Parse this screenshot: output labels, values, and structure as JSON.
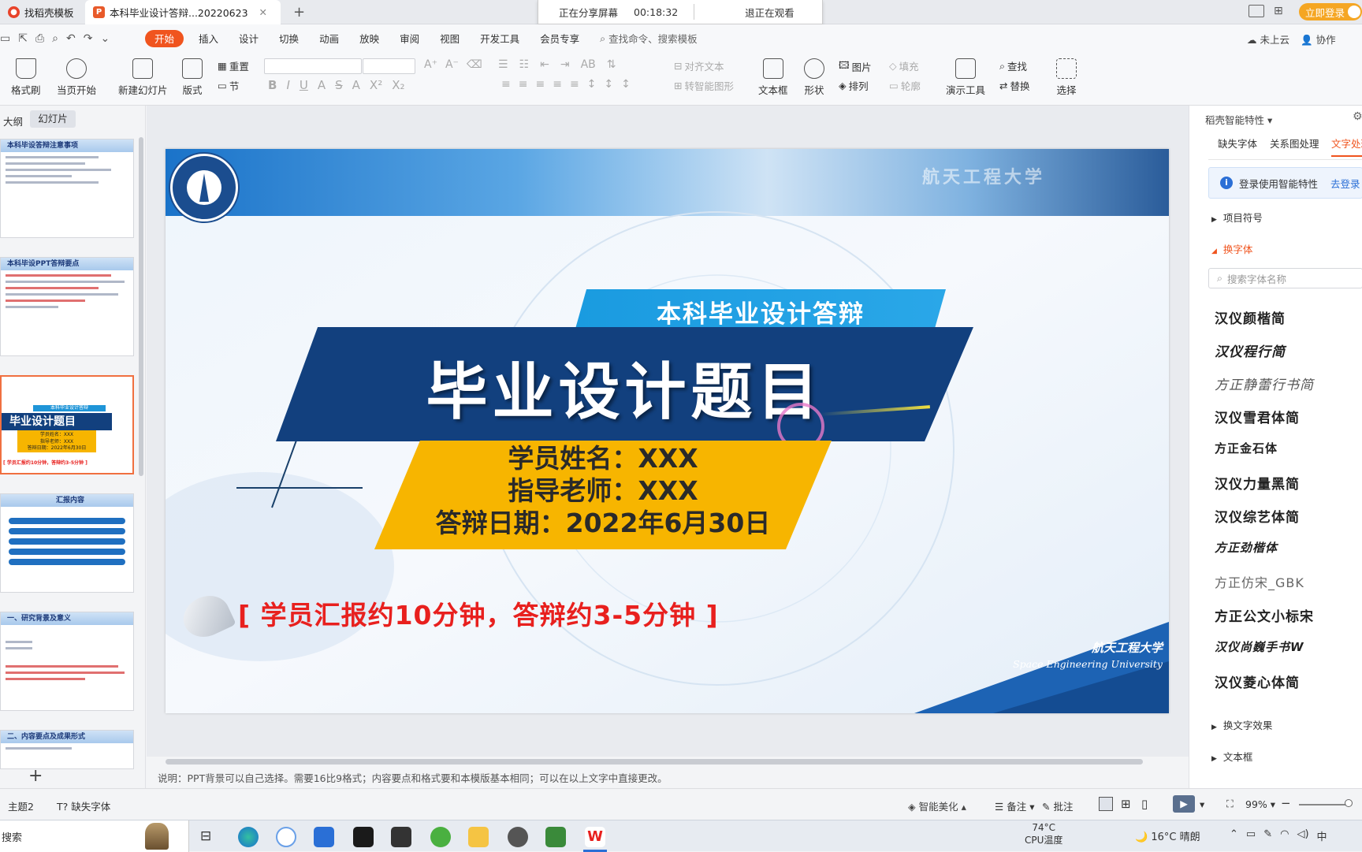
{
  "tabs": {
    "tab1": "找稻壳模板",
    "tab2": "本科毕业设计答辩...20220623",
    "new_tab": "+"
  },
  "share_bar": {
    "status": "正在分享屏幕",
    "timer": "00:18:32",
    "exit": "退正在观看"
  },
  "title_right": {
    "login": "立即登录"
  },
  "menu": {
    "items": [
      "开始",
      "插入",
      "设计",
      "切换",
      "动画",
      "放映",
      "审阅",
      "视图",
      "开发工具",
      "会员专享"
    ],
    "search": "查找命令、搜索模板",
    "cloud": "未上云",
    "collab": "协作"
  },
  "ribbon": {
    "format_painter": "格式刷",
    "play_current": "当页开始",
    "new_slide": "新建幻灯片",
    "layout": "版式",
    "reset": "重置",
    "section": "节",
    "align_text": "对齐文本",
    "smart_shape": "转智能图形",
    "textbox": "文本框",
    "shape": "形状",
    "picture": "图片",
    "fill": "填充",
    "arrange": "排列",
    "outline": "轮廓",
    "presenter": "演示工具",
    "find": "查找",
    "replace": "替换",
    "select": "选择"
  },
  "left_panel": {
    "outline_tab": "大纲",
    "slides_tab": "幻灯片",
    "thumb1_title": "本科毕设答辩注意事项",
    "thumb2_title": "本科毕设PPT答辩要点",
    "thumb3_sub": "本科毕业设计答辩",
    "thumb3_title": "毕业设计题目",
    "thumb3_line1": "学员姓名：XXX",
    "thumb3_line2": "指导老师：XXX",
    "thumb3_line3": "答辩日期：2022年6月30日",
    "thumb3_note": "[ 学员汇报约10分钟，答辩约3-5分钟 ]",
    "thumb4_title": "汇报内容",
    "thumb5_title": "一、研究背景及意义",
    "thumb6_title": "二、内容要点及成果形式",
    "add": "+"
  },
  "slide": {
    "banner_text": "航天工程大学",
    "subtitle": "本科毕业设计答辩",
    "title": "毕业设计题目",
    "student": "学员姓名：XXX",
    "advisor": "指导老师：XXX",
    "date": "答辩日期：2022年6月30日",
    "note": "[ 学员汇报约10分钟，答辩约3-5分钟 ]",
    "univ_cn": "航天工程大学",
    "univ_en": "Space Engineering University"
  },
  "notes": {
    "text": "说明：PPT背景可以自己选择。需要16比9格式；内容要点和格式要和本模版基本相同；可以在以上文字中直接更改。"
  },
  "right_panel": {
    "header": "稻壳智能特性",
    "tab1": "缺失字体",
    "tab2": "关系图处理",
    "tab3": "文字处理",
    "login_hint": "登录使用智能特性",
    "login_link": "去登录",
    "bullets": "项目符号",
    "change_font": "换字体",
    "font_search": "搜索字体名称",
    "fonts": [
      "汉仪颜楷简",
      "汉仪程行简",
      "方正静蕾行书简",
      "汉仪雪君体简",
      "方正金石体",
      "汉仪力量黑简",
      "汉仪综艺体简",
      "方正劲楷体",
      "方正仿宋_GBK",
      "方正公文小标宋",
      "汉仪尚巍手书W",
      "汉仪菱心体简"
    ],
    "text_effect": "换文字效果",
    "textbox": "文本框"
  },
  "status": {
    "theme": "主题2",
    "missing_font": "缺失字体",
    "beautify": "智能美化",
    "notes": "备注",
    "comment": "批注",
    "zoom": "99%"
  },
  "taskbar": {
    "search": "搜索",
    "cpu_temp": "74°C",
    "cpu_label": "CPU温度",
    "weather": "16°C 晴朗",
    "ime": "中"
  },
  "colors": {
    "accent": "#f0541e",
    "navy": "#12407e",
    "gold": "#f7b500",
    "red_note": "#e8201e"
  }
}
